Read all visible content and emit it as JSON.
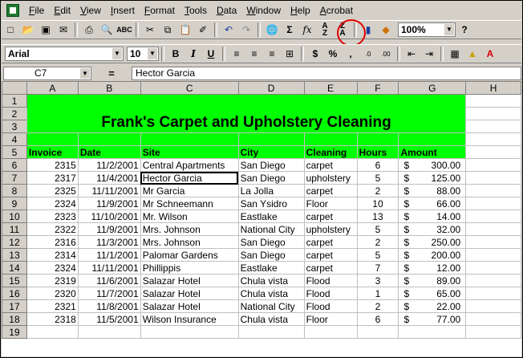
{
  "menu": [
    "File",
    "Edit",
    "View",
    "Insert",
    "Format",
    "Tools",
    "Data",
    "Window",
    "Help",
    "Acrobat"
  ],
  "toolbar": {
    "zoom": "100%",
    "font": "Arial",
    "size": "10"
  },
  "formula": {
    "cell_ref": "C7",
    "equals": "=",
    "value": "Hector Garcia"
  },
  "columns": [
    "A",
    "B",
    "C",
    "D",
    "E",
    "F",
    "G",
    "H"
  ],
  "title": "Frank's Carpet and Upholstery Cleaning",
  "headers": [
    "Invoice",
    "Date",
    "Site",
    "City",
    "Cleaning",
    "Hours",
    "Amount"
  ],
  "rows": [
    {
      "invoice": "2315",
      "date": "11/2/2001",
      "site": "Central Apartments",
      "city": "San Diego",
      "cleaning": "carpet",
      "hours": "6",
      "cur": "$",
      "amount": "300.00"
    },
    {
      "invoice": "2317",
      "date": "11/4/2001",
      "site": "Hector Garcia",
      "city": "San Diego",
      "cleaning": "upholstery",
      "hours": "5",
      "cur": "$",
      "amount": "125.00"
    },
    {
      "invoice": "2325",
      "date": "11/11/2001",
      "site": "Mr Garcia",
      "city": "La Jolla",
      "cleaning": "carpet",
      "hours": "2",
      "cur": "$",
      "amount": "88.00"
    },
    {
      "invoice": "2324",
      "date": "11/9/2001",
      "site": "Mr Schneemann",
      "city": "San Ysidro",
      "cleaning": "Floor",
      "hours": "10",
      "cur": "$",
      "amount": "66.00"
    },
    {
      "invoice": "2323",
      "date": "11/10/2001",
      "site": "Mr. Wilson",
      "city": "Eastlake",
      "cleaning": "carpet",
      "hours": "13",
      "cur": "$",
      "amount": "14.00"
    },
    {
      "invoice": "2322",
      "date": "11/9/2001",
      "site": "Mrs. Johnson",
      "city": "National City",
      "cleaning": "upholstery",
      "hours": "5",
      "cur": "$",
      "amount": "32.00"
    },
    {
      "invoice": "2316",
      "date": "11/3/2001",
      "site": "Mrs. Johnson",
      "city": "San Diego",
      "cleaning": "carpet",
      "hours": "2",
      "cur": "$",
      "amount": "250.00"
    },
    {
      "invoice": "2314",
      "date": "11/1/2001",
      "site": "Palomar Gardens",
      "city": "San Diego",
      "cleaning": "carpet",
      "hours": "5",
      "cur": "$",
      "amount": "200.00"
    },
    {
      "invoice": "2324",
      "date": "11/11/2001",
      "site": "Phillippis",
      "city": "Eastlake",
      "cleaning": "carpet",
      "hours": "7",
      "cur": "$",
      "amount": "12.00"
    },
    {
      "invoice": "2319",
      "date": "11/6/2001",
      "site": "Salazar Hotel",
      "city": "Chula vista",
      "cleaning": "Flood",
      "hours": "3",
      "cur": "$",
      "amount": "89.00"
    },
    {
      "invoice": "2320",
      "date": "11/7/2001",
      "site": "Salazar Hotel",
      "city": "Chula vista",
      "cleaning": "Flood",
      "hours": "1",
      "cur": "$",
      "amount": "65.00"
    },
    {
      "invoice": "2321",
      "date": "11/8/2001",
      "site": "Salazar Hotel",
      "city": "National City",
      "cleaning": "Flood",
      "hours": "2",
      "cur": "$",
      "amount": "22.00"
    },
    {
      "invoice": "2318",
      "date": "11/5/2001",
      "site": "Wilson Insurance",
      "city": "Chula vista",
      "cleaning": "Floor",
      "hours": "6",
      "cur": "$",
      "amount": "77.00"
    }
  ],
  "row_numbers": [
    "1",
    "2",
    "3",
    "4",
    "5",
    "6",
    "7",
    "8",
    "9",
    "10",
    "11",
    "12",
    "13",
    "14",
    "15",
    "16",
    "17",
    "18",
    "19"
  ]
}
